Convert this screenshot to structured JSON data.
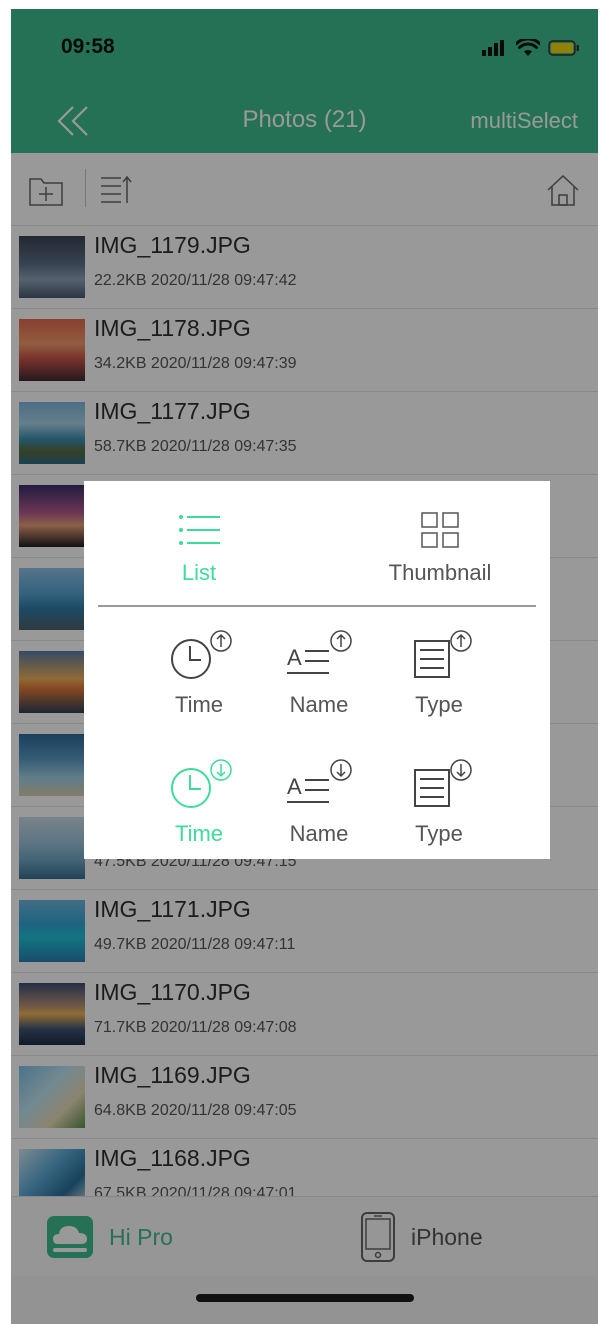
{
  "status": {
    "time": "09:58"
  },
  "nav": {
    "title": "Photos (21)",
    "multi_select": "multiSelect"
  },
  "files": [
    {
      "name": "IMG_1179.JPG",
      "meta": "22.2KB 2020/11/28 09:47:42"
    },
    {
      "name": "IMG_1178.JPG",
      "meta": "34.2KB 2020/11/28 09:47:39"
    },
    {
      "name": "IMG_1177.JPG",
      "meta": "58.7KB 2020/11/28 09:47:35"
    },
    {
      "name": "",
      "meta": ""
    },
    {
      "name": "",
      "meta": ""
    },
    {
      "name": "",
      "meta": ""
    },
    {
      "name": "",
      "meta": ""
    },
    {
      "name": "",
      "meta": "47.5KB 2020/11/28 09:47:15"
    },
    {
      "name": "IMG_1171.JPG",
      "meta": "49.7KB 2020/11/28 09:47:11"
    },
    {
      "name": "IMG_1170.JPG",
      "meta": "71.7KB 2020/11/28 09:47:08"
    },
    {
      "name": "IMG_1169.JPG",
      "meta": "64.8KB 2020/11/28 09:47:05"
    },
    {
      "name": "IMG_1168.JPG",
      "meta": "67.5KB 2020/11/28 09:47:01"
    }
  ],
  "tabs": {
    "hipro": "Hi Pro",
    "iphone": "iPhone"
  },
  "popup": {
    "view": {
      "list": "List",
      "thumbnail": "Thumbnail"
    },
    "sort_asc": {
      "time": "Time",
      "name": "Name",
      "type": "Type"
    },
    "sort_desc": {
      "time": "Time",
      "name": "Name",
      "type": "Type"
    },
    "active_view": "list",
    "active_sort": "time-descending"
  },
  "colors": {
    "brand": "#3dbd8e",
    "accent": "#3ddc9a",
    "text": "#2f2f2f",
    "battery": "#f5d60a"
  }
}
